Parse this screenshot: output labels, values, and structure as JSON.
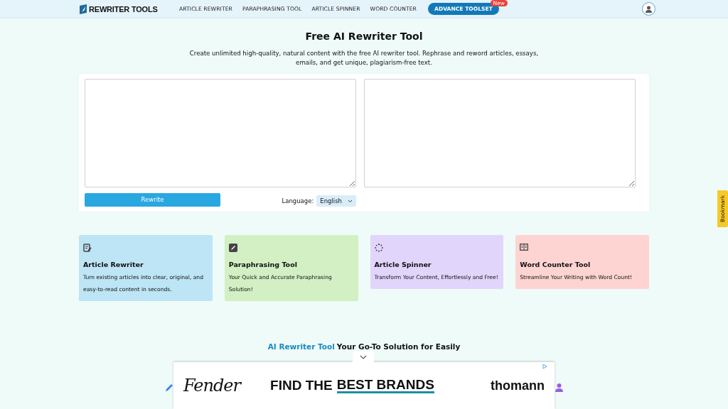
{
  "header": {
    "logo": "REWRITER TOOLS",
    "nav": [
      {
        "label": "ARTICLE REWRITER",
        "kind": "link"
      },
      {
        "label": "PARAPHRASING TOOL",
        "kind": "link"
      },
      {
        "label": "ARTICLE SPINNER",
        "kind": "link"
      },
      {
        "label": "WORD COUNTER",
        "kind": "link"
      },
      {
        "label": "ADVANCE TOOLSET",
        "kind": "pill",
        "badge": "New"
      }
    ]
  },
  "title": "Free AI Rewriter Tool",
  "intro": "Create unlimited high-quality, natural content with the free AI rewriter tool. Rephrase and reword articles, essays, emails, and get unique, plagiarism-free text.",
  "editor": {
    "button": "Rewrite",
    "language_label": "Language:",
    "language": "English"
  },
  "tools": [
    {
      "title": "Article Rewriter",
      "text": "Turn existing articles into clear, original, and easy-to-read content in seconds.",
      "color": "#bde5f5",
      "kind": "doc"
    },
    {
      "title": "Paraphrasing Tool",
      "text": "Your Quick and Accurate Paraphrasing Solution!",
      "color": "#d2f0c4",
      "kind": "pencil"
    },
    {
      "title": "Article Spinner",
      "text": "Transform Your Content, Effortlessly and Free!",
      "color": "#e2d5fc",
      "kind": "spinner"
    },
    {
      "title": "Word Counter Tool",
      "text": "Streamline Your Writing with Word Count!",
      "color": "#fdd4d2",
      "kind": "book"
    }
  ],
  "section_heading": {
    "highlight": "AI Rewriter Tool",
    "rest": "Your Go-To Solution for Easily"
  },
  "bookmark": "Bookmark",
  "ad": {
    "logo_left": "Fender",
    "headline_1": "FIND THE",
    "headline_2": "BEST BRANDS",
    "logo_right": "thomann"
  }
}
